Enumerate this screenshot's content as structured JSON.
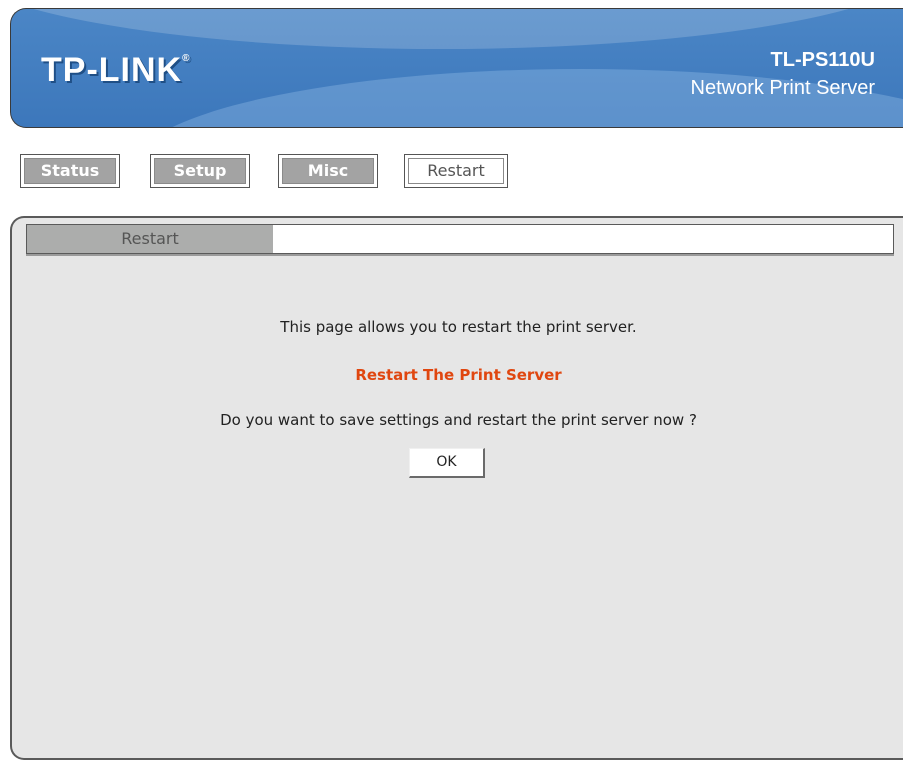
{
  "header": {
    "logo": "TP-LINK",
    "model": "TL-PS110U",
    "product": "Network Print Server"
  },
  "nav": {
    "status_label": "Status",
    "setup_label": "Setup",
    "misc_label": "Misc",
    "restart_label": "Restart",
    "active": "Restart"
  },
  "panel": {
    "tab_label": "Restart",
    "intro": "This page allows you to restart the print server.",
    "title": "Restart The Print Server",
    "question": "Do you want to save settings and restart the print server now ?",
    "ok_label": "OK"
  },
  "colors": {
    "header_blue": "#3c77bb",
    "title_orange": "#e0460f",
    "panel_gray": "#e6e6e6",
    "tab_gray": "#acadac"
  }
}
